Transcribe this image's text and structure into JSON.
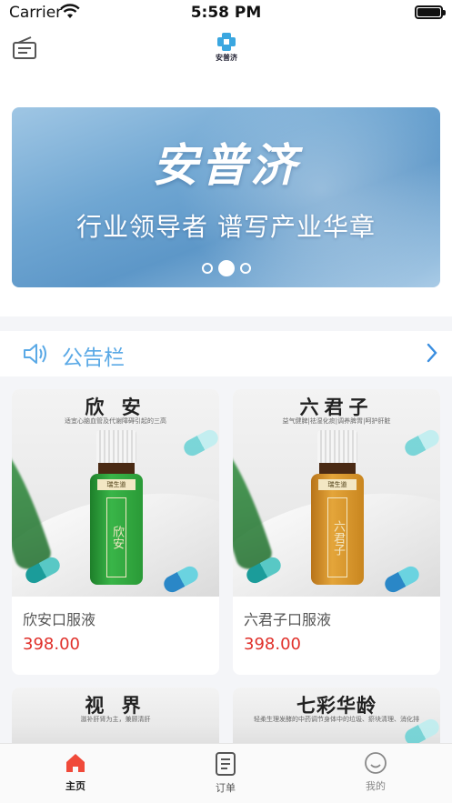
{
  "status_bar": {
    "carrier": "Carrier",
    "time": "5:58 PM"
  },
  "nav": {
    "logo_text": "安普济"
  },
  "banner": {
    "title": "安普济",
    "slogan": "行业领导者 谱写产业华章",
    "slide_count": 3,
    "active_slide": 2
  },
  "notice": {
    "label": "公告栏"
  },
  "products": [
    {
      "heading": "欣 安",
      "subtitle": "适宜心脑血管及代谢障碍引起的三高",
      "bottle_label": "欣安",
      "brand": "瑞生道",
      "name": "欣安口服液",
      "price": "398.00",
      "color": "#2fa23d"
    },
    {
      "heading": "六君子",
      "subtitle": "益气健脾|祛湿化痰|调养脾胃|呵护肝脏",
      "bottle_label": "六君子",
      "brand": "瑞生道",
      "name": "六君子口服液",
      "price": "398.00",
      "color": "#d9962a"
    },
    {
      "heading": "视 界",
      "subtitle": "滋补肝肾为主，兼顾清肝"
    },
    {
      "heading": "七彩华龄",
      "subtitle": "轻柔生理发酵的中药调节身体中的垃圾、瘀块清理、消化排"
    }
  ],
  "tabs": [
    {
      "label": "主页",
      "icon": "home-icon",
      "active": true,
      "color": "#f04a3a"
    },
    {
      "label": "订单",
      "icon": "orders-icon",
      "active": false
    },
    {
      "label": "我的",
      "icon": "profile-icon",
      "active": false
    }
  ],
  "colors": {
    "accent": "#5aa9e6",
    "price": "#e0302a",
    "tab_active": "#f04a3a"
  }
}
